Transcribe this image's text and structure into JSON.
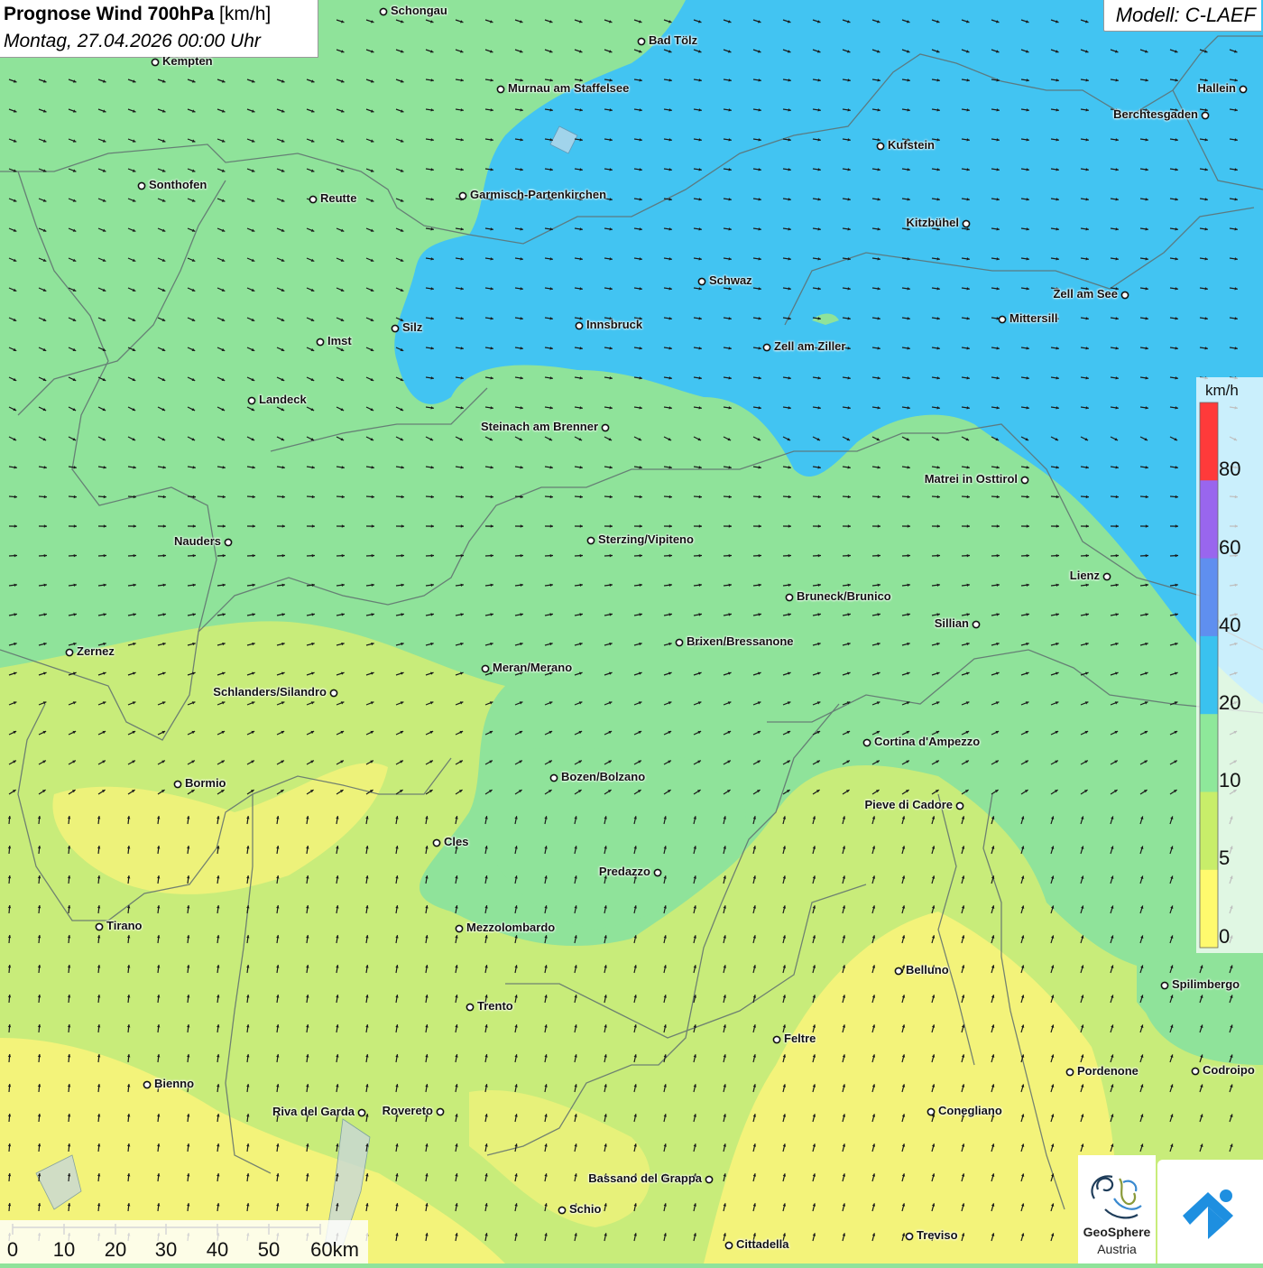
{
  "header": {
    "title_bold": "Prognose Wind 700hPa",
    "title_unit": "[km/h]",
    "datetime": "Montag, 27.04.2026 00:00 Uhr",
    "model": "Modell: C-LAEF"
  },
  "legend": {
    "unit": "km/h",
    "ticks": [
      "80",
      "60",
      "40",
      "20",
      "10",
      "5",
      "0"
    ],
    "colors": [
      "#ff3a3a",
      "#9966ee",
      "#5f8fef",
      "#3ac2ef",
      "#8ee89a",
      "#c8ee6a",
      "#fffa6e"
    ]
  },
  "scale_bar": {
    "labels": [
      "0",
      "10",
      "20",
      "30",
      "40",
      "50",
      "60km"
    ]
  },
  "colors": {
    "wind_0_5": "#f3f37a",
    "wind_5_10": "#c8ec7a",
    "wind_10_20": "#8fe39a",
    "wind_20_40": "#42c4f2"
  },
  "cities": [
    {
      "name": "Schongau"
    },
    {
      "name": "Bad Tölz"
    },
    {
      "name": "Kempten"
    },
    {
      "name": "Murnau am Staffelsee"
    },
    {
      "name": "Hallein"
    },
    {
      "name": "Berchtesgaden"
    },
    {
      "name": "Kufstein"
    },
    {
      "name": "Sonthofen"
    },
    {
      "name": "Reutte"
    },
    {
      "name": "Garmisch-Partenkirchen"
    },
    {
      "name": "Kitzbühel"
    },
    {
      "name": "Schwaz"
    },
    {
      "name": "Zell am See"
    },
    {
      "name": "Mittersill"
    },
    {
      "name": "Silz"
    },
    {
      "name": "Innsbruck"
    },
    {
      "name": "Imst"
    },
    {
      "name": "Zell am Ziller"
    },
    {
      "name": "Landeck"
    },
    {
      "name": "Steinach am Brenner"
    },
    {
      "name": "Matrei in Osttirol"
    },
    {
      "name": "Nauders"
    },
    {
      "name": "Sterzing/Vipiteno"
    },
    {
      "name": "Lienz"
    },
    {
      "name": "Bruneck/Brunico"
    },
    {
      "name": "Sillian"
    },
    {
      "name": "Zernez"
    },
    {
      "name": "Brixen/Bressanone"
    },
    {
      "name": "Meran/Merano"
    },
    {
      "name": "Schlanders/Silandro"
    },
    {
      "name": "Cortina d'Ampezzo"
    },
    {
      "name": "Bormio"
    },
    {
      "name": "Bozen/Bolzano"
    },
    {
      "name": "Pieve di Cadore"
    },
    {
      "name": "Cles"
    },
    {
      "name": "Predazzo"
    },
    {
      "name": "Tirano"
    },
    {
      "name": "Mezzolombardo"
    },
    {
      "name": "Belluno"
    },
    {
      "name": "Spilimbergo"
    },
    {
      "name": "Trento"
    },
    {
      "name": "Feltre"
    },
    {
      "name": "Pordenone"
    },
    {
      "name": "Codroipo"
    },
    {
      "name": "Bienno"
    },
    {
      "name": "Riva del Garda"
    },
    {
      "name": "Rovereto"
    },
    {
      "name": "Conegliano"
    },
    {
      "name": "Bassano del Grappa"
    },
    {
      "name": "Schio"
    },
    {
      "name": "Treviso"
    },
    {
      "name": "Cittadella"
    }
  ],
  "logos": {
    "geosphere_line1": "GeoSphere",
    "geosphere_line2": "Austria"
  }
}
